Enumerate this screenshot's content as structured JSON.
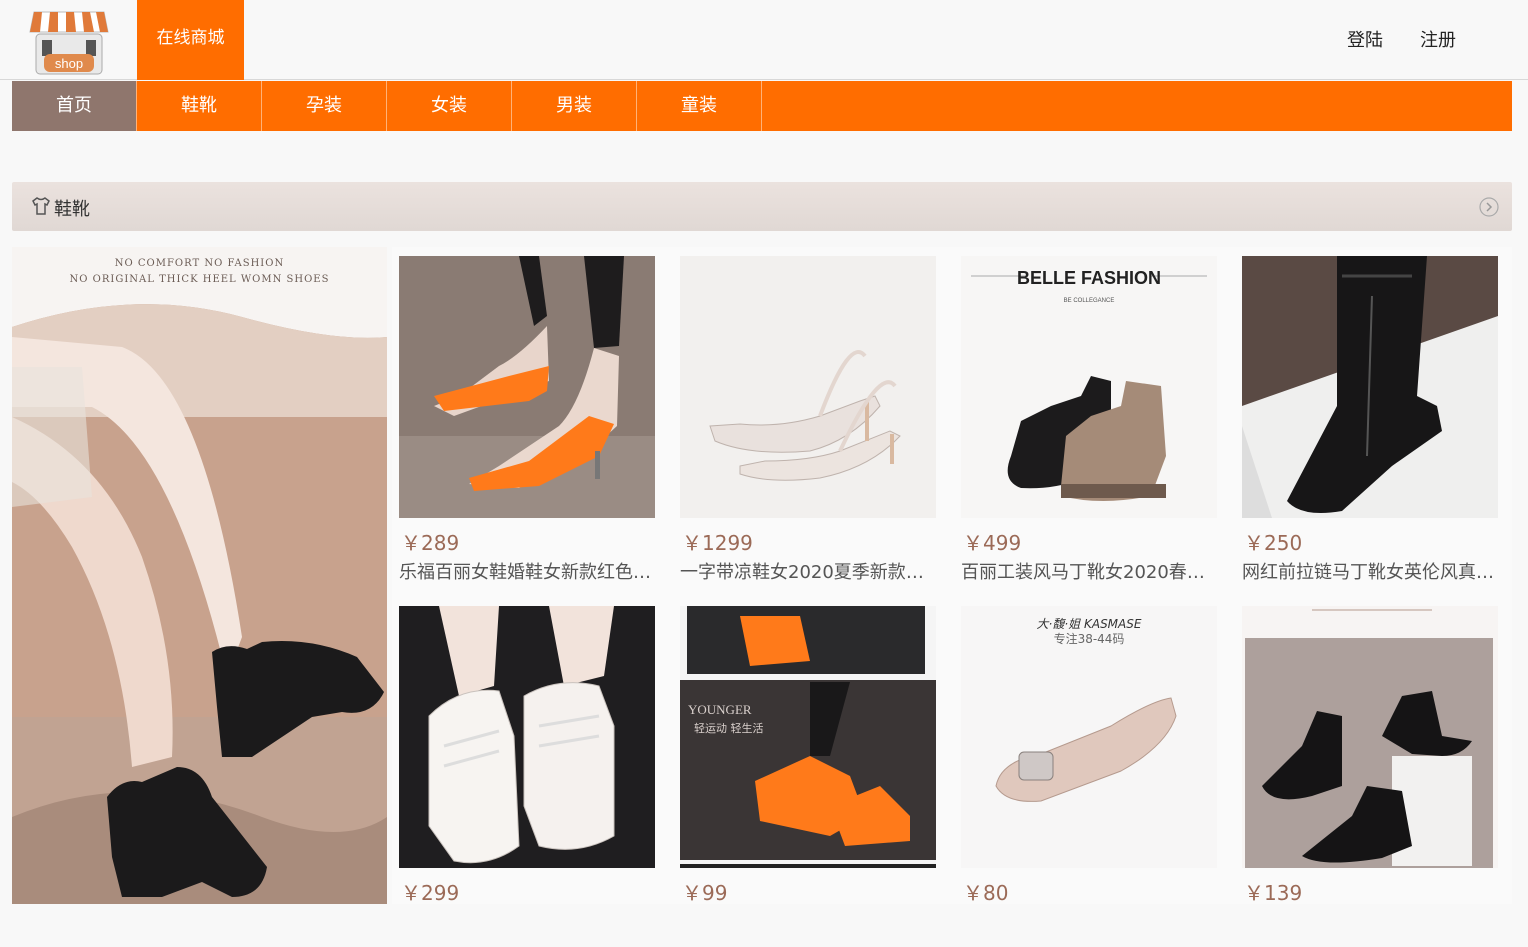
{
  "header": {
    "logo_text": "shop",
    "site_name": "在线商城",
    "login_label": "登陆",
    "register_label": "注册"
  },
  "nav": {
    "items": [
      {
        "label": "首页",
        "active": true
      },
      {
        "label": "鞋靴",
        "active": false
      },
      {
        "label": "孕装",
        "active": false
      },
      {
        "label": "女装",
        "active": false
      },
      {
        "label": "男装",
        "active": false
      },
      {
        "label": "童装",
        "active": false
      }
    ]
  },
  "section": {
    "title": "鞋靴",
    "icon": "shirt-icon",
    "more_icon": "chevron-right-circle-icon"
  },
  "banner": {
    "line1": "NO COMFORT  NO FASHION",
    "line2": "NO ORIGINAL THICK HEEL WOMN SHOES"
  },
  "products": [
    {
      "price": "￥289",
      "name": "乐福百丽女鞋婚鞋女新款红色…",
      "image_text": ""
    },
    {
      "price": "￥1299",
      "name": "一字带凉鞋女2020夏季新款白…",
      "image_text": ""
    },
    {
      "price": "￥499",
      "name": "百丽工装风马丁靴女2020春季…",
      "image_text": "BELLE FASHION",
      "image_subtext": "BE COLLEGANCE"
    },
    {
      "price": "￥250",
      "name": "网红前拉链马丁靴女英伦风真…",
      "image_text": ""
    },
    {
      "price": "￥299",
      "name": "",
      "image_text": ""
    },
    {
      "price": "￥99",
      "name": "",
      "image_text": "YOUNGER",
      "image_subtext": "轻运动 轻生活"
    },
    {
      "price": "￥80",
      "name": "",
      "image_text": "大·馥·姐 KASMASE",
      "image_subtext": "专注38-44码"
    },
    {
      "price": "￥139",
      "name": "",
      "image_text": ""
    }
  ],
  "colors": {
    "accent": "#ff6d00",
    "nav_active": "#8f766d",
    "price": "#9b6a57"
  }
}
